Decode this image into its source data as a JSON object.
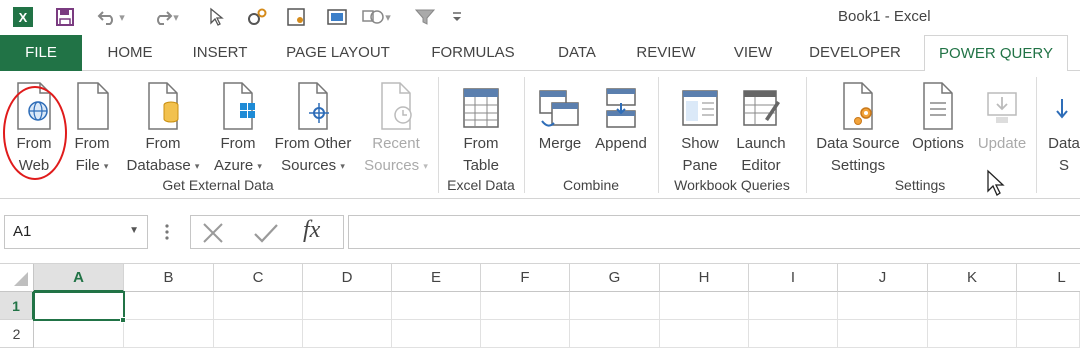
{
  "window": {
    "title": "Book1 - Excel"
  },
  "qat": {
    "items": [
      {
        "name": "excel-logo-icon"
      },
      {
        "name": "save-icon"
      },
      {
        "name": "undo-icon"
      },
      {
        "name": "redo-icon"
      },
      {
        "name": "pointer-icon"
      },
      {
        "name": "macro-gear-icon"
      },
      {
        "name": "form-icon"
      },
      {
        "name": "screen-icon"
      },
      {
        "name": "shapes-icon"
      },
      {
        "name": "filter-icon"
      },
      {
        "name": "customize-qat-icon"
      }
    ]
  },
  "tabs": [
    "FILE",
    "HOME",
    "INSERT",
    "PAGE LAYOUT",
    "FORMULAS",
    "DATA",
    "REVIEW",
    "VIEW",
    "DEVELOPER",
    "POWER QUERY"
  ],
  "active_tab": "POWER QUERY",
  "ribbon": {
    "get_external": {
      "label": "Get External Data",
      "from_web": [
        "From",
        "Web"
      ],
      "from_file": [
        "From",
        "File"
      ],
      "from_database": [
        "From",
        "Database"
      ],
      "from_azure": [
        "From",
        "Azure"
      ],
      "from_other": [
        "From Other",
        "Sources"
      ],
      "recent": [
        "Recent",
        "Sources"
      ]
    },
    "excel_data": {
      "label": "Excel Data",
      "from_table": [
        "From",
        "Table"
      ]
    },
    "combine": {
      "label": "Combine",
      "merge": "Merge",
      "append": "Append"
    },
    "workbook_queries": {
      "label": "Workbook Queries",
      "show_pane": [
        "Show",
        "Pane"
      ],
      "launch_editor": [
        "Launch",
        "Editor"
      ]
    },
    "settings": {
      "label": "Settings",
      "data_source": [
        "Data Source",
        "Settings"
      ],
      "options": "Options",
      "update": "Update"
    },
    "overflow": [
      "Data",
      "S"
    ]
  },
  "formula_bar": {
    "name_box": "A1",
    "formula": ""
  },
  "grid": {
    "columns": [
      "A",
      "B",
      "C",
      "D",
      "E",
      "F",
      "G",
      "H",
      "I",
      "J",
      "K",
      "L"
    ],
    "rows": [
      "1",
      "2"
    ],
    "active_cell": "A1"
  },
  "colors": {
    "accent": "#217346",
    "annotation": "#e01b1b"
  }
}
